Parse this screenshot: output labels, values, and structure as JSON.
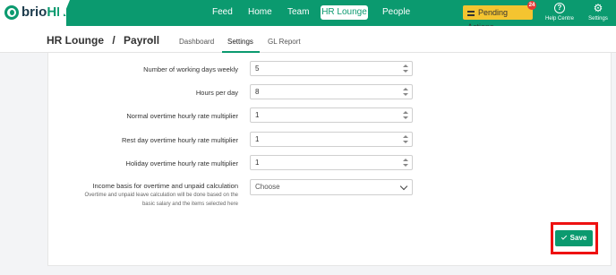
{
  "brand": {
    "name_part1": "brio",
    "name_part2": "HR"
  },
  "nav": {
    "items": [
      {
        "label": "Feed"
      },
      {
        "label": "Home"
      },
      {
        "label": "Team"
      },
      {
        "label": "HR Lounge",
        "active": true
      },
      {
        "label": "People"
      }
    ],
    "pending_actions": {
      "label": "Pending Actions",
      "count": "24"
    },
    "help": {
      "label": "Help Centre"
    },
    "settings": {
      "label": "Settings"
    }
  },
  "header": {
    "breadcrumb_1": "HR Lounge",
    "separator": "/",
    "breadcrumb_2": "Payroll",
    "tabs": [
      {
        "label": "Dashboard"
      },
      {
        "label": "Settings",
        "active": true
      },
      {
        "label": "GL Report"
      }
    ]
  },
  "form": {
    "fields": [
      {
        "label": "Number of working days weekly",
        "value": "5"
      },
      {
        "label": "Hours per day",
        "value": "8"
      },
      {
        "label": "Normal overtime hourly rate multiplier",
        "value": "1"
      },
      {
        "label": "Rest day overtime hourly rate multiplier",
        "value": "1"
      },
      {
        "label": "Holiday overtime hourly rate multiplier",
        "value": "1"
      }
    ],
    "income_basis": {
      "label": "Income basis for overtime and unpaid calculation",
      "note_line1": "Overtime and unpaid leave calculation will be done based on the",
      "note_line2": "basic salary and the items selected here",
      "selected": "Choose"
    },
    "save_label": "Save"
  },
  "colors": {
    "accent": "#0b9a6f",
    "pending": "#f4c430",
    "highlight": "#e11111"
  }
}
